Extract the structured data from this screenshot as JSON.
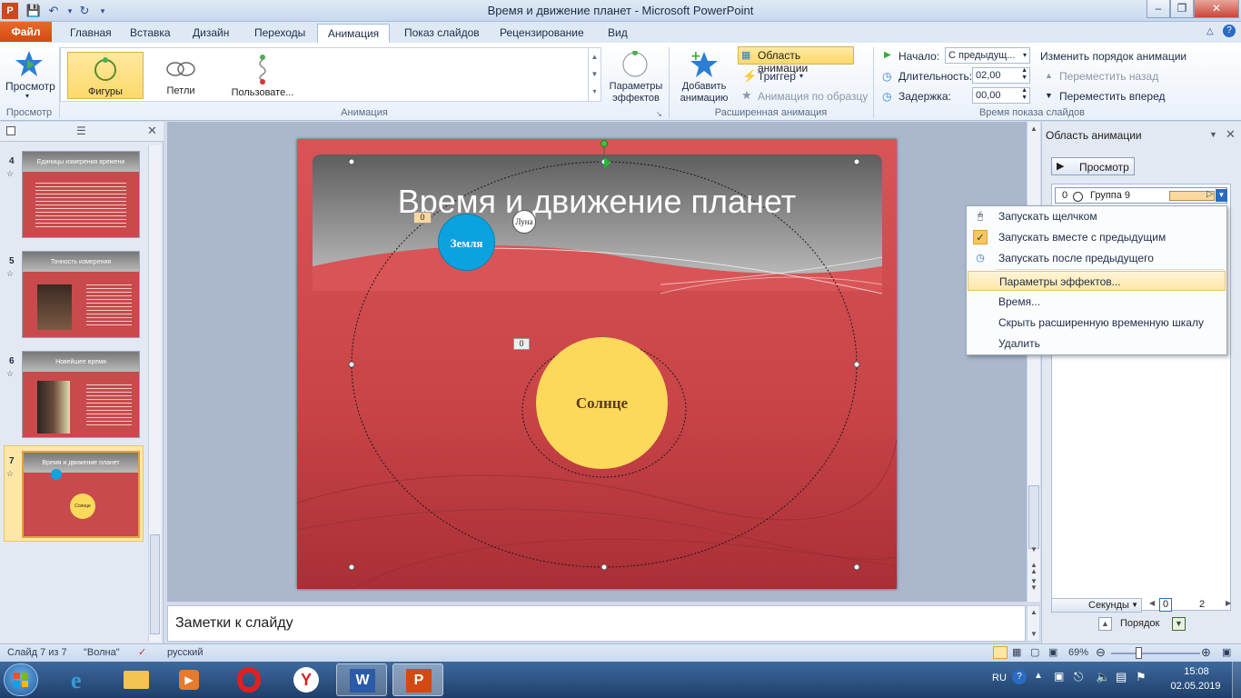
{
  "window": {
    "title": "Время и движение планет - Microsoft PowerPoint"
  },
  "tabs": [
    "Файл",
    "Главная",
    "Вставка",
    "Дизайн",
    "Переходы",
    "Анимация",
    "Показ слайдов",
    "Рецензирование",
    "Вид"
  ],
  "ribbon": {
    "preview_label": "Просмотр",
    "preview_group": "Просмотр",
    "effects": [
      "Фигуры",
      "Петли",
      "Пользовате..."
    ],
    "animation_group": "Анимация",
    "effect_params": "Параметры эффектов",
    "add_animation": "Добавить анимацию",
    "anim_pane_btn": "Область анимации",
    "trigger": "Триггер",
    "anim_painter": "Анимация по образцу",
    "advanced_group": "Расширенная анимация",
    "start_label": "Начало:",
    "start_value": "С предыдущ...",
    "duration_label": "Длительность:",
    "duration_value": "02,00",
    "delay_label": "Задержка:",
    "delay_value": "00,00",
    "reorder_title": "Изменить порядок анимации",
    "move_back": "Переместить назад",
    "move_forward": "Переместить вперед",
    "timing_group": "Время показа слайдов"
  },
  "slides": [
    {
      "num": "4",
      "title": "Единицы измерения времени"
    },
    {
      "num": "5",
      "title": "Точность измерения"
    },
    {
      "num": "6",
      "title": "Новейшее время"
    },
    {
      "num": "7",
      "title": "Время и движение планет",
      "sun": "Солнце"
    }
  ],
  "slide": {
    "title": "Время и движение планет",
    "earth": "Земля",
    "moon": "Луна",
    "sun": "Солнце",
    "tag_earth": "0",
    "tag_sun": "0"
  },
  "notes": {
    "placeholder": "Заметки к слайду"
  },
  "anim_pane": {
    "title": "Область анимации",
    "preview": "Просмотр",
    "item_index": "0",
    "item_name": "Группа 9",
    "seconds": "Секунды",
    "tick0": "0",
    "tick2": "2",
    "order": "Порядок"
  },
  "menu": [
    "Запускать щелчком",
    "Запускать вместе с предыдущим",
    "Запускать после предыдущего",
    "Параметры эффектов...",
    "Время...",
    "Скрыть расширенную временную шкалу",
    "Удалить"
  ],
  "status": {
    "slide": "Слайд 7 из 7",
    "theme": "\"Волна\"",
    "lang": "русский",
    "zoom": "69%"
  },
  "taskbar": {
    "lang": "RU",
    "time": "15:08",
    "date": "02.05.2019"
  },
  "colors": {
    "accent": "#d24a12",
    "slide_red": "#c84447",
    "earth": "#0aa3e0",
    "sun": "#fcd95a"
  }
}
